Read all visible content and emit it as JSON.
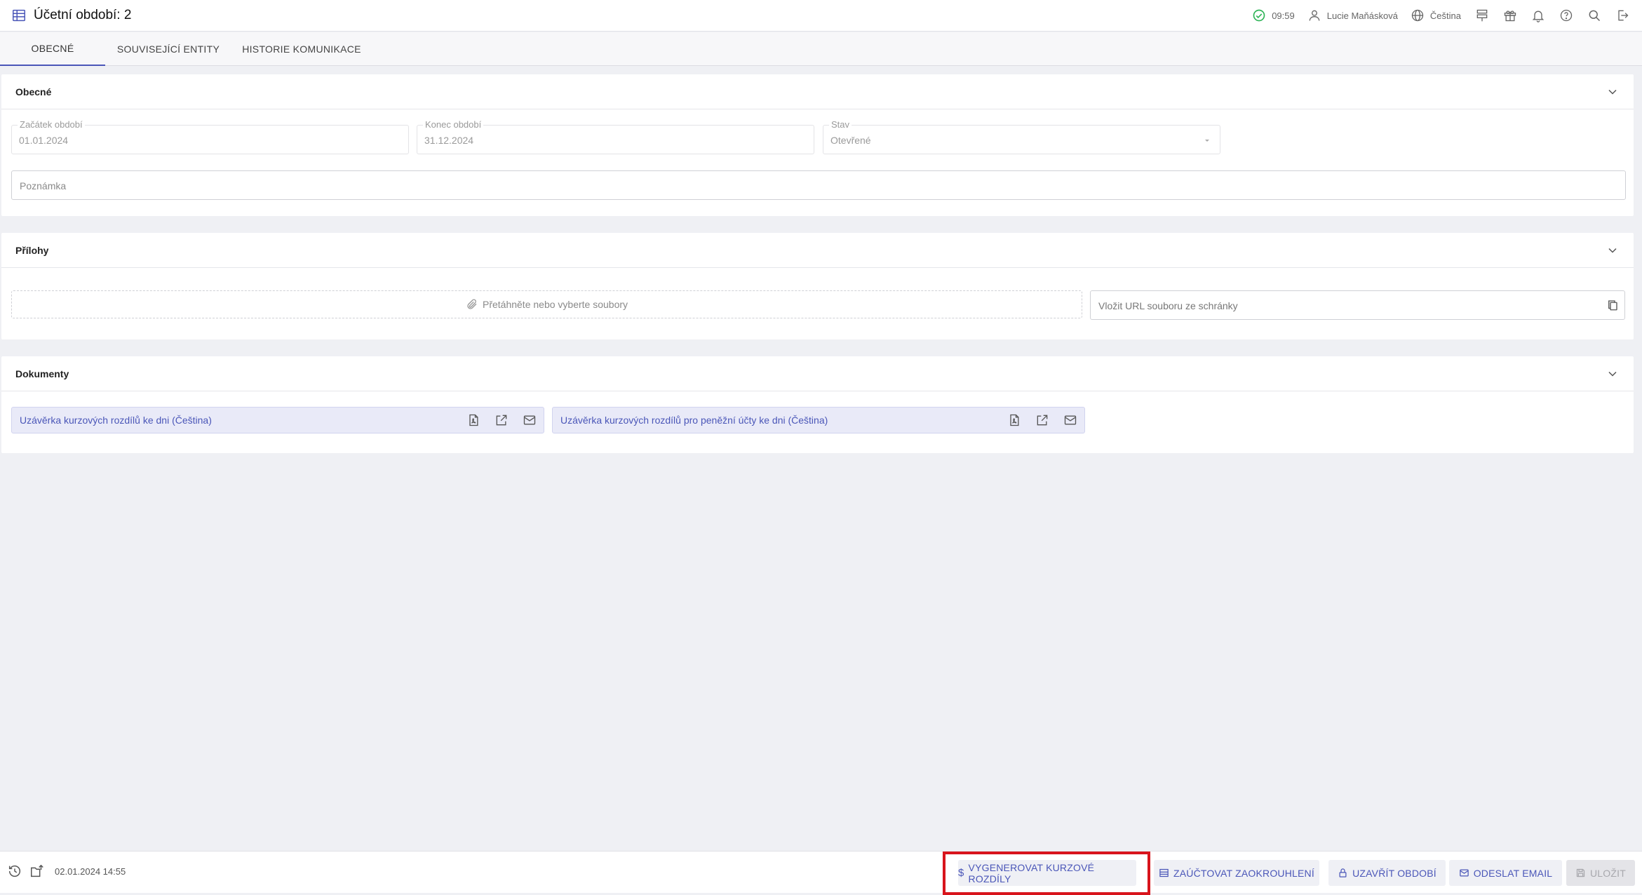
{
  "header": {
    "title": "Účetní období: 2",
    "time": "09:59",
    "user": "Lucie Maňásková",
    "language": "Čeština"
  },
  "tabs": [
    {
      "label": "OBECNÉ",
      "active": true
    },
    {
      "label": "SOUVISEJÍCÍ ENTITY",
      "active": false
    },
    {
      "label": "HISTORIE KOMUNIKACE",
      "active": false
    }
  ],
  "general": {
    "title": "Obecné",
    "start_label": "Začátek období",
    "start_value": "01.01.2024",
    "end_label": "Konec období",
    "end_value": "31.12.2024",
    "state_label": "Stav",
    "state_value": "Otevřené",
    "note_placeholder": "Poznámka"
  },
  "attachments": {
    "title": "Přílohy",
    "dropzone_text": "Přetáhněte nebo vyberte soubory",
    "url_placeholder": "Vložit URL souboru ze schránky"
  },
  "documents": {
    "title": "Dokumenty",
    "items": [
      {
        "label": "Uzávěrka kurzových rozdílů ke dni (Čeština)"
      },
      {
        "label": "Uzávěrka kurzových rozdílů pro peněžní účty ke dni (Čeština)"
      }
    ]
  },
  "footer": {
    "timestamp": "02.01.2024 14:55",
    "buttons": {
      "generate": "VYGENEROVAT KURZOVÉ ROZDÍLY",
      "rounding": "ZAÚČTOVAT ZAOKROUHLENÍ",
      "close_period": "UZAVŘÍT OBDOBÍ",
      "send_email": "ODESLAT EMAIL",
      "save": "ULOŽIT"
    }
  },
  "colors": {
    "accent": "#4a56b8",
    "highlight": "#d8141c",
    "status_ok": "#2fb457"
  }
}
